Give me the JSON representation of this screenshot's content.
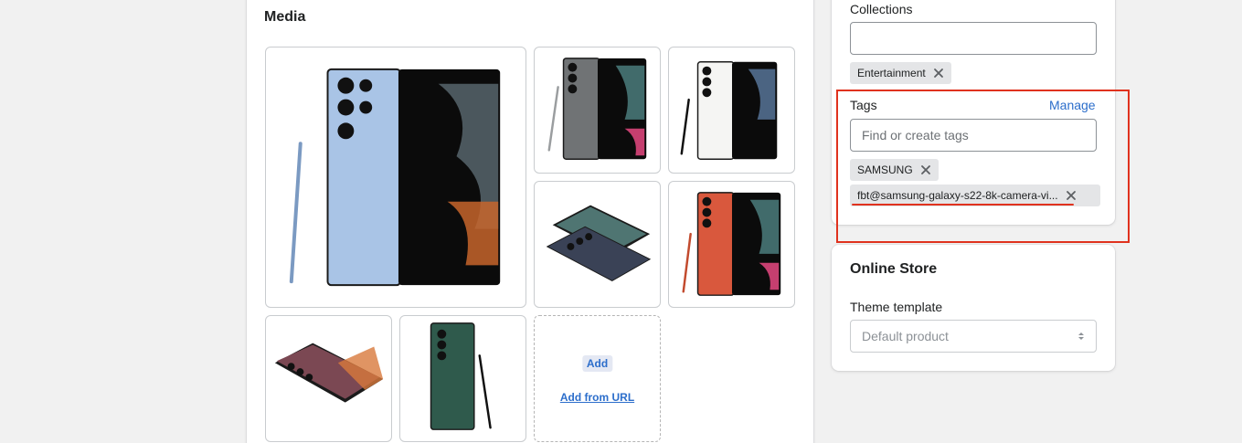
{
  "media": {
    "title": "Media",
    "images": [
      {
        "name": "galaxy-s22-ultra-sky-blue",
        "color": "#a8c3e6"
      },
      {
        "name": "galaxy-s22-ultra-graphite",
        "color": "#6b6e70"
      },
      {
        "name": "galaxy-s22-ultra-white",
        "color": "#f2f2f0"
      },
      {
        "name": "galaxy-s22-ultra-flat-dark",
        "color": "#3a4256"
      },
      {
        "name": "galaxy-s22-ultra-red",
        "color": "#d9583d"
      },
      {
        "name": "galaxy-s22-ultra-burgundy",
        "color": "#7b4853"
      },
      {
        "name": "galaxy-s22-ultra-green",
        "color": "#2f5a4c"
      }
    ],
    "add_label": "Add",
    "add_from_url_label": "Add from URL"
  },
  "organization": {
    "collections_label": "Collections",
    "collections_value": "",
    "collection_chips": [
      "Entertainment"
    ],
    "tags_label": "Tags",
    "manage_label": "Manage",
    "tags_placeholder": "Find or create tags",
    "tag_chips": [
      "SAMSUNG",
      "fbt@samsung-galaxy-s22-8k-camera-vi..."
    ]
  },
  "online_store": {
    "title": "Online Store",
    "theme_template_label": "Theme template",
    "theme_template_value": "Default product"
  },
  "colors": {
    "accent": "#2c6ecb",
    "highlight": "#e0321e"
  }
}
